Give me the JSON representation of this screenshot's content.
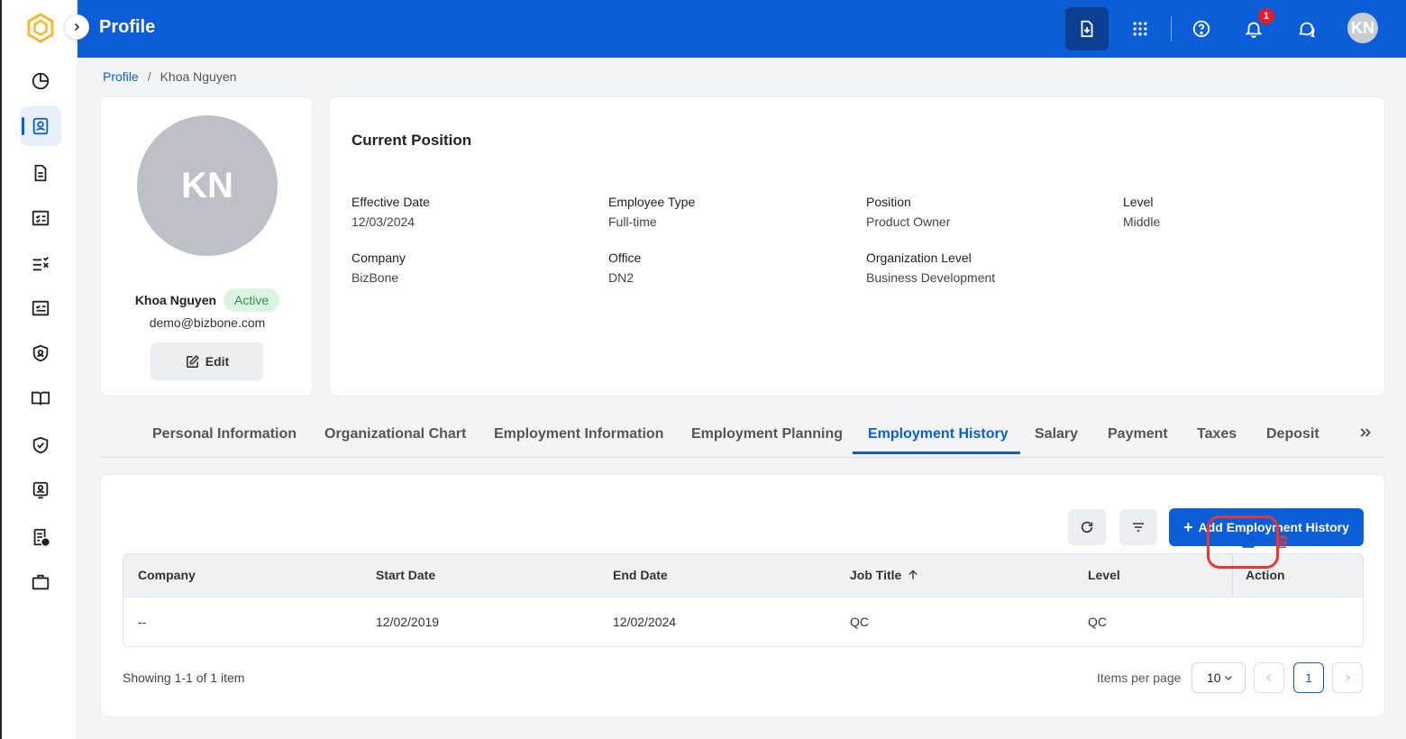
{
  "header": {
    "title": "Profile",
    "notification_count": "1",
    "user_initials": "KN"
  },
  "breadcrumb": {
    "root": "Profile",
    "current": "Khoa Nguyen"
  },
  "sidebar": {
    "items": [
      {
        "icon": "dashboard-icon"
      },
      {
        "icon": "profile-icon",
        "active": true
      },
      {
        "icon": "document-icon"
      },
      {
        "icon": "checklist-icon"
      },
      {
        "icon": "task-list-icon"
      },
      {
        "icon": "approval-icon"
      },
      {
        "icon": "security-icon"
      },
      {
        "icon": "book-icon"
      },
      {
        "icon": "shield-check-icon"
      },
      {
        "icon": "badge-icon"
      },
      {
        "icon": "report-icon"
      },
      {
        "icon": "briefcase-icon"
      }
    ]
  },
  "profile": {
    "initials": "KN",
    "name": "Khoa Nguyen",
    "status": "Active",
    "email": "demo@bizbone.com",
    "edit_label": "Edit"
  },
  "current_position": {
    "title": "Current Position",
    "fields": [
      {
        "label": "Effective Date",
        "value": "12/03/2024"
      },
      {
        "label": "Employee Type",
        "value": "Full-time"
      },
      {
        "label": "Position",
        "value": "Product Owner"
      },
      {
        "label": "Level",
        "value": "Middle"
      },
      {
        "label": "Company",
        "value": "BizBone"
      },
      {
        "label": "Office",
        "value": "DN2"
      },
      {
        "label": "Organization Level",
        "value": "Business Development"
      }
    ]
  },
  "tabs": [
    {
      "label": "Personal Information"
    },
    {
      "label": "Organizational Chart"
    },
    {
      "label": "Employment Information"
    },
    {
      "label": "Employment Planning"
    },
    {
      "label": "Employment History",
      "active": true
    },
    {
      "label": "Salary"
    },
    {
      "label": "Payment"
    },
    {
      "label": "Taxes"
    },
    {
      "label": "Deposit"
    }
  ],
  "toolbar": {
    "add_label": "Add Employment History"
  },
  "table": {
    "columns": [
      "Company",
      "Start Date",
      "End Date",
      "Job Title",
      "Level",
      "Action"
    ],
    "rows": [
      {
        "company": "--",
        "start_date": "12/02/2019",
        "end_date": "12/02/2024",
        "job_title": "QC",
        "level": "QC"
      }
    ]
  },
  "pagination": {
    "showing": "Showing 1-1 of 1 item",
    "items_per_page_label": "Items per page",
    "items_per_page": "10",
    "current_page": "1"
  },
  "colors": {
    "primary": "#0b5ed7",
    "danger": "#e53935",
    "success_bg": "#dcf5e2",
    "success_text": "#2f8f4a"
  }
}
